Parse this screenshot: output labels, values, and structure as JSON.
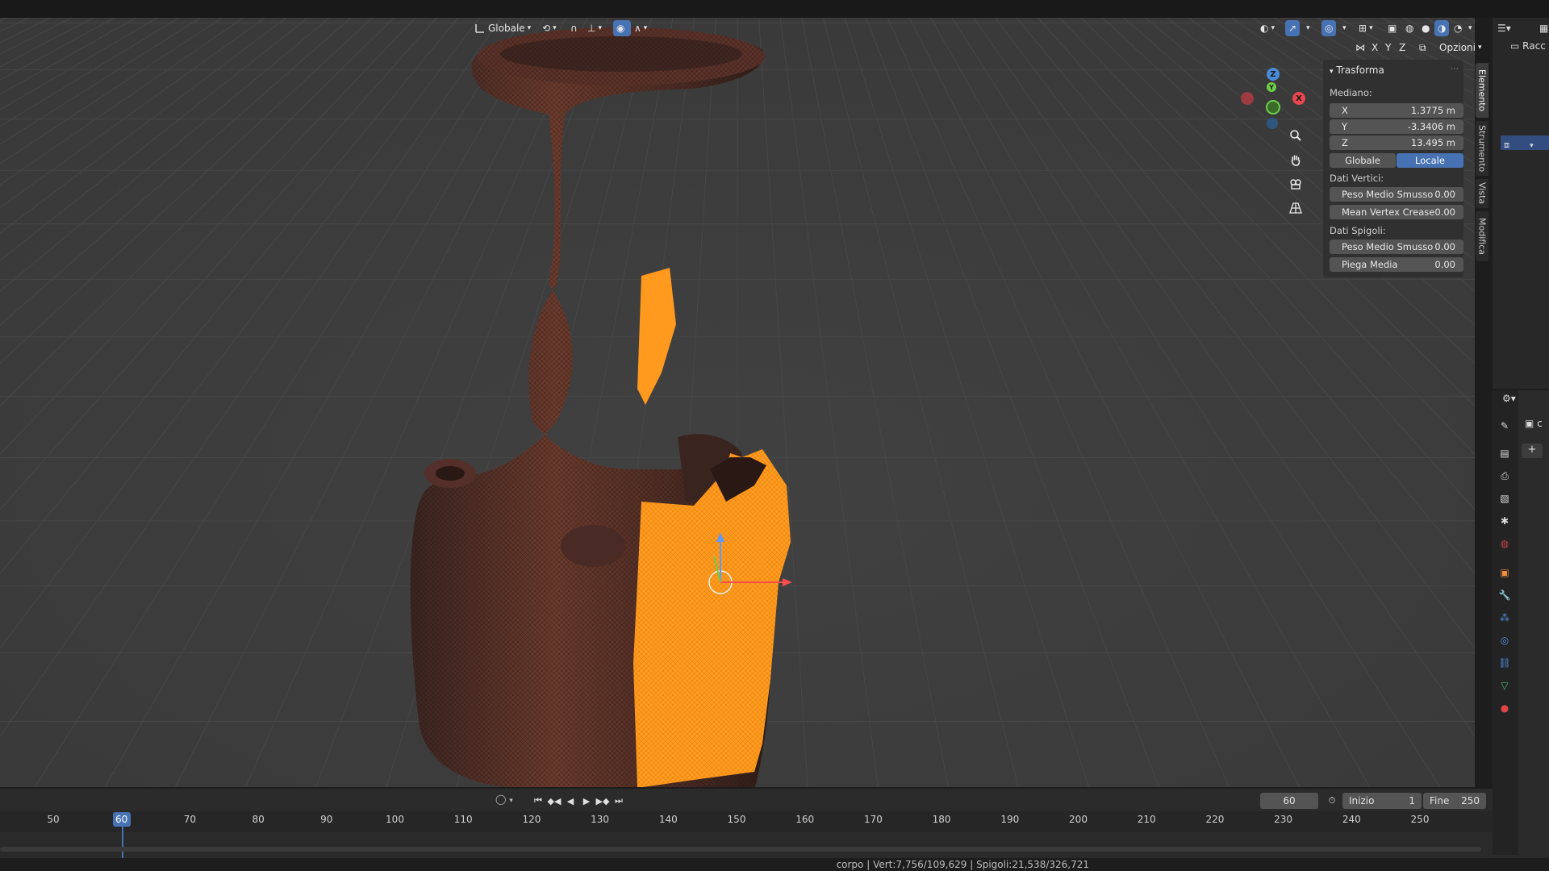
{
  "header": {
    "orientation_label": "Globale",
    "options_label": "Opzioni",
    "axis_locks": [
      "X",
      "Y",
      "Z"
    ]
  },
  "n_panel": {
    "section_title": "Trasforma",
    "median_label": "Mediano:",
    "x": {
      "label": "X",
      "value": "1.3775 m"
    },
    "y": {
      "label": "Y",
      "value": "-3.3406 m"
    },
    "z": {
      "label": "Z",
      "value": "13.495 m"
    },
    "space_global": "Globale",
    "space_local": "Locale",
    "vertex_data_label": "Dati Vertici:",
    "vertex_bevel": {
      "label": "Peso Medio Smusso",
      "value": "0.00"
    },
    "vertex_crease": {
      "label": "Mean Vertex Crease",
      "value": "0.00"
    },
    "edge_data_label": "Dati Spigoli:",
    "edge_bevel": {
      "label": "Peso Medio Smusso",
      "value": "0.00"
    },
    "edge_crease": {
      "label": "Piega Media",
      "value": "0.00"
    }
  },
  "side_tabs": [
    "Elemento",
    "Strumento",
    "Vista",
    "Modifica"
  ],
  "gizmo": {
    "x": "X",
    "y": "Y",
    "z": "Z"
  },
  "outliner": {
    "header_text": "Racc"
  },
  "properties": {
    "tab_text": "c"
  },
  "timeline": {
    "current_frame": "60",
    "start_label": "Inizio",
    "start_value": "1",
    "end_label": "Fine",
    "end_value": "250",
    "ruler": [
      "50",
      "60",
      "70",
      "80",
      "90",
      "100",
      "110",
      "120",
      "130",
      "140",
      "150",
      "160",
      "170",
      "180",
      "190",
      "200",
      "210",
      "220",
      "230",
      "240",
      "250"
    ]
  },
  "status_bar": "corpo | Vert:7,756/109,629 | Spigoli:21,538/326,721",
  "colors": {
    "accent": "#4772b3",
    "selection": "#ff9a1f",
    "mesh": "#5a2f27"
  }
}
